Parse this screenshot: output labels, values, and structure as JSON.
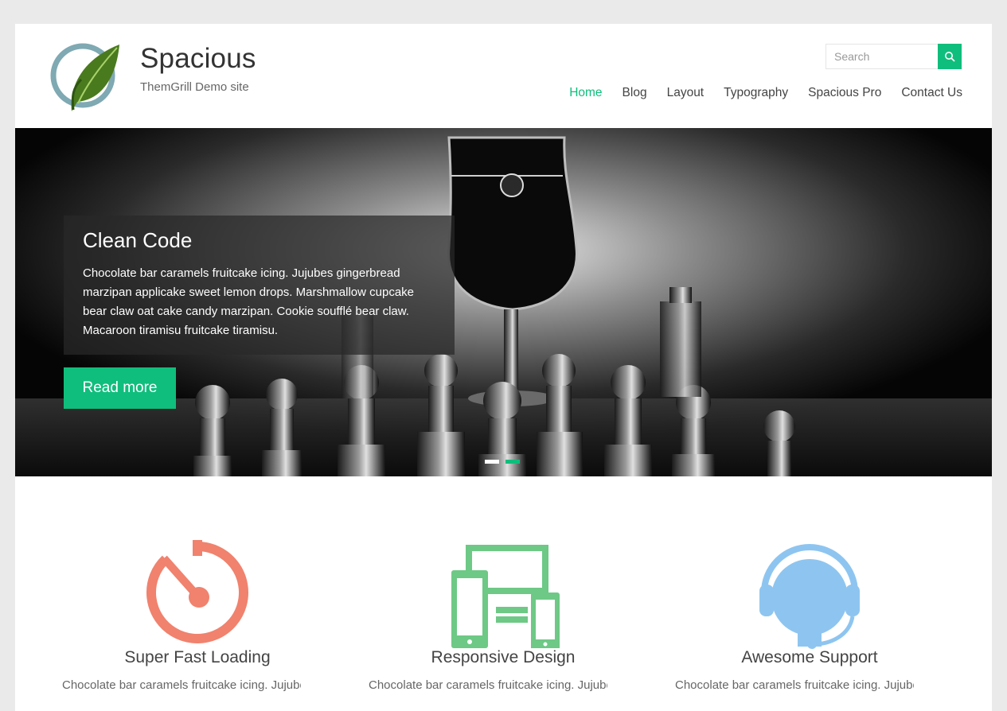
{
  "site": {
    "title": "Spacious",
    "description": "ThemGrill Demo site"
  },
  "search": {
    "placeholder": "Search",
    "value": ""
  },
  "nav": {
    "items": [
      {
        "label": "Home",
        "active": true
      },
      {
        "label": "Blog"
      },
      {
        "label": "Layout"
      },
      {
        "label": "Typography"
      },
      {
        "label": "Spacious Pro"
      },
      {
        "label": "Contact Us"
      }
    ]
  },
  "slider": {
    "title": "Clean Code",
    "text": "Chocolate bar caramels fruitcake icing. Jujubes gingerbread marzipan applicake sweet lemon drops. Marshmallow cupcake bear claw oat cake candy marzipan. Cookie soufflé bear claw. Macaroon tiramisu fruitcake tiramisu.",
    "button_label": "Read more",
    "slides": 2,
    "active_slide": 2
  },
  "features": [
    {
      "title": "Super Fast Loading",
      "icon": "stopwatch-icon",
      "color": "#f0826e",
      "text": "Chocolate bar caramels fruitcake icing. Jujubes"
    },
    {
      "title": "Responsive Design",
      "icon": "devices-icon",
      "color": "#6dc985",
      "text": "Chocolate bar caramels fruitcake icing. Jujubes"
    },
    {
      "title": "Awesome Support",
      "icon": "headset-icon",
      "color": "#8ec5f0",
      "text": "Chocolate bar caramels fruitcake icing. Jujubes"
    }
  ],
  "colors": {
    "accent": "#0fbe7c",
    "background": "#eaeaea"
  }
}
